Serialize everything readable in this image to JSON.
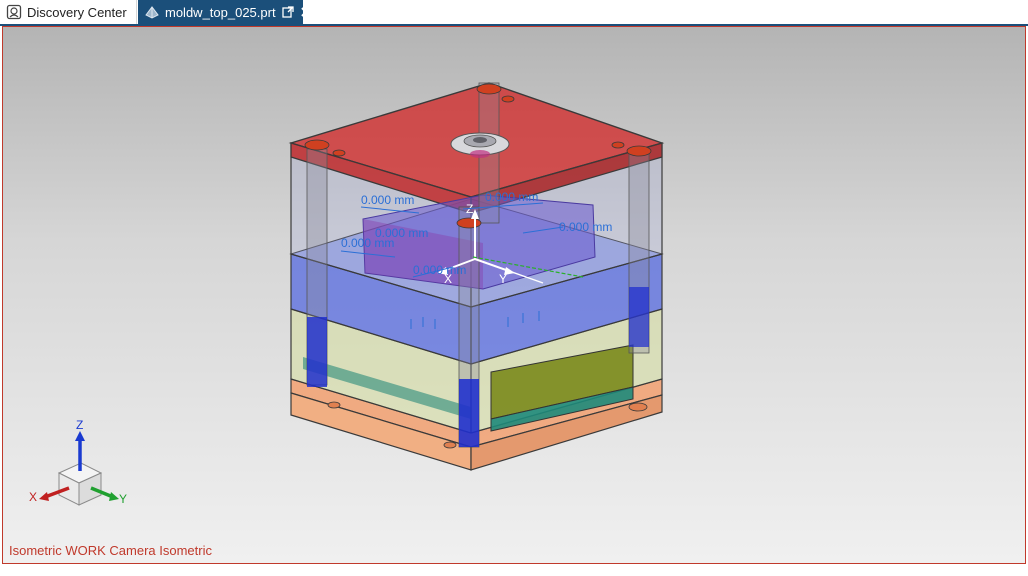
{
  "tabs": [
    {
      "label": "Discovery Center",
      "icon": "discovery-center-icon",
      "active": false
    },
    {
      "label": "moldw_top_025.prt",
      "icon": "part-file-icon",
      "active": true
    }
  ],
  "viewport": {
    "status": "Isometric WORK Camera Isometric",
    "dimensions": [
      "0.000 mm",
      "0.000 mm",
      "0.000 mm",
      "0.000 mm",
      "0.000 mm",
      "0.000 mm"
    ],
    "csys_labels": {
      "x": "X",
      "y": "Y",
      "z": "Z"
    },
    "triad_labels": {
      "x": "X",
      "y": "Y",
      "z": "Z"
    }
  },
  "colors": {
    "accent": "#1b4f7a",
    "border": "#c0392b",
    "dimension": "#2b6fd6",
    "plate_top": "#d12a2a",
    "plate_cavity": "#3a52e0",
    "plate_core": "#c8d88a",
    "plate_bottom": "#f2a070"
  }
}
